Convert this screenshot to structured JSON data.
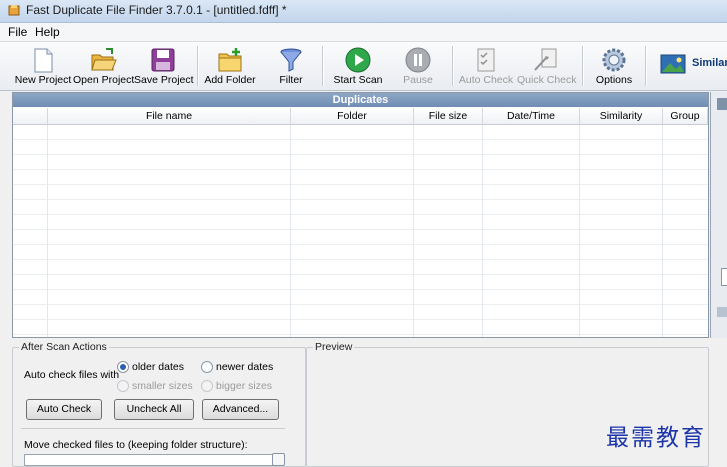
{
  "window": {
    "title": "Fast Duplicate File Finder 3.7.0.1 - [untitled.fdff] *"
  },
  "menu": [
    "File",
    "Help"
  ],
  "toolbar": {
    "new_project": "New Project",
    "open_project": "Open Project",
    "save_project": "Save Project",
    "add_folder": "Add Folder",
    "filter": "Filter",
    "start_scan": "Start Scan",
    "pause": "Pause",
    "auto_check": "Auto Check",
    "quick_check": "Quick Check",
    "options": "Options",
    "similar": "Similar"
  },
  "duplicates": {
    "header": "Duplicates",
    "columns": [
      "File name",
      "Folder",
      "File size",
      "Date/Time",
      "Similarity",
      "Group"
    ]
  },
  "after_scan": {
    "title": "After Scan Actions",
    "auto_check_label": "Auto check files with",
    "older_dates": "older dates",
    "newer_dates": "newer dates",
    "smaller_sizes": "smaller sizes",
    "bigger_sizes": "bigger sizes",
    "auto_check_btn": "Auto Check",
    "uncheck_all_btn": "Uncheck All",
    "advanced_btn": "Advanced...",
    "move_label": "Move checked files to (keeping folder structure):"
  },
  "preview": {
    "title": "Preview"
  },
  "watermark": "最需教育",
  "colors": {
    "accent": "#2b5fb0",
    "header_blue": "#7b97bd",
    "watermark": "#1d35a8"
  }
}
